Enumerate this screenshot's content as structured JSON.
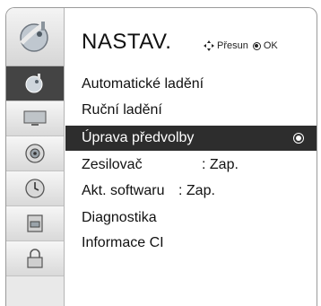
{
  "header": {
    "title": "NASTAV.",
    "hint_move": "Přesun",
    "hint_ok": "OK"
  },
  "sidebar": {
    "items": [
      {
        "icon": "satellite-dish-icon",
        "active": true
      },
      {
        "icon": "monitor-icon",
        "active": false
      },
      {
        "icon": "speaker-icon",
        "active": false
      },
      {
        "icon": "clock-icon",
        "active": false
      },
      {
        "icon": "lock-panel-icon",
        "active": false
      },
      {
        "icon": "padlock-icon",
        "active": false
      }
    ]
  },
  "menu": {
    "items": [
      {
        "label": "Automatické ladění",
        "value": ""
      },
      {
        "label": "Ruční ladění",
        "value": ""
      },
      {
        "label": "Úprava předvolby",
        "value": "",
        "selected": true
      },
      {
        "label": "Zesilovač",
        "value": ": Zap."
      },
      {
        "label": "Akt. softwaru",
        "value": ": Zap."
      },
      {
        "label": "Diagnostika",
        "value": ""
      },
      {
        "label": "Informace CI",
        "value": ""
      }
    ]
  },
  "colors": {
    "selection": "#2d2d2d",
    "active_side": "#444444",
    "border": "#9a9a9a"
  }
}
